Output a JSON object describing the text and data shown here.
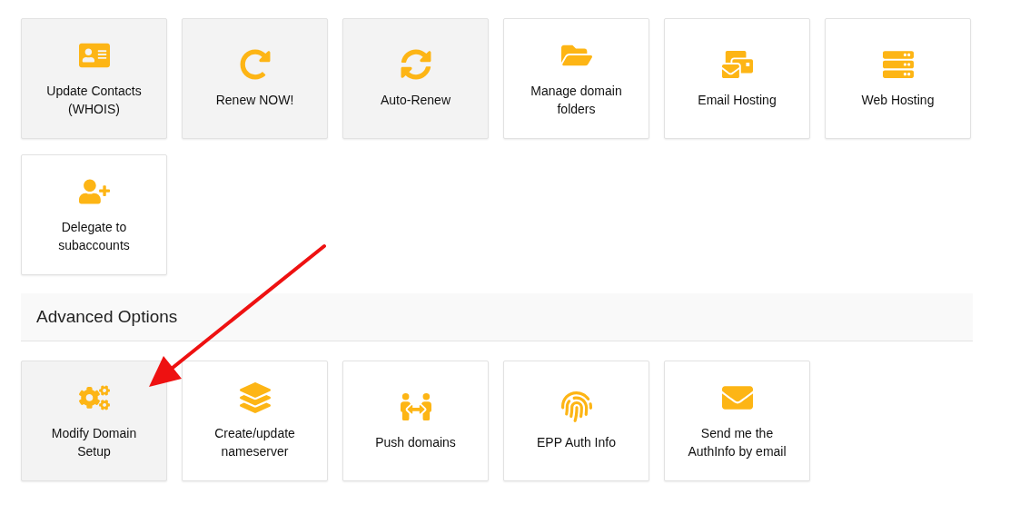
{
  "tiles": [
    {
      "label": "Update Contacts (WHOIS)",
      "highlighted": true
    },
    {
      "label": "Renew NOW!",
      "highlighted": true
    },
    {
      "label": "Auto-Renew",
      "highlighted": true
    },
    {
      "label": "Manage domain folders",
      "highlighted": false
    },
    {
      "label": "Email Hosting",
      "highlighted": false
    },
    {
      "label": "Web Hosting",
      "highlighted": false
    },
    {
      "label": "Delegate to subaccounts",
      "highlighted": false
    }
  ],
  "advanced": {
    "title": "Advanced Options",
    "tiles": [
      {
        "label": "Modify Domain Setup",
        "highlighted": true
      },
      {
        "label": "Create/update nameserver",
        "highlighted": false
      },
      {
        "label": "Push domains",
        "highlighted": false
      },
      {
        "label": "EPP Auth Info",
        "highlighted": false
      },
      {
        "label": "Send me the AuthInfo by email",
        "highlighted": false
      }
    ]
  }
}
